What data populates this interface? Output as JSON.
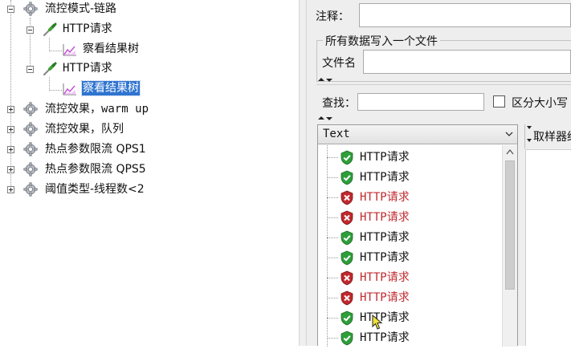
{
  "tree": {
    "items": [
      {
        "label": "流控模式-链路",
        "expander": "minus",
        "icon": "gear-icon"
      },
      {
        "label": "HTTP请求",
        "expander": "minus",
        "icon": "pipette-icon"
      },
      {
        "label": "察看结果树",
        "icon": "graph-icon"
      },
      {
        "label": "HTTP请求",
        "expander": "minus",
        "icon": "pipette-icon"
      },
      {
        "label": "察看结果树",
        "icon": "graph-icon",
        "selected": true
      },
      {
        "label": "流控效果，warm up",
        "expander": "plus",
        "icon": "gear-icon"
      },
      {
        "label": "流控效果，队列",
        "expander": "plus",
        "icon": "gear-icon"
      },
      {
        "label": "热点参数限流 QPS1",
        "expander": "plus",
        "icon": "gear-icon"
      },
      {
        "label": "热点参数限流 QPS5",
        "expander": "plus",
        "icon": "gear-icon"
      },
      {
        "label": "阈值类型-线程数<2",
        "expander": "plus",
        "icon": "gear-icon"
      }
    ]
  },
  "form": {
    "comment_label": "注释：",
    "comment_value": "",
    "fieldset_title": "所有数据写入一个文件",
    "filename_label": "文件名",
    "filename_value": ""
  },
  "search": {
    "label": "查找：",
    "value": "",
    "case_label": "区分大小写",
    "case_checked": false
  },
  "results": {
    "renderer": "Text",
    "rows": [
      {
        "label": "HTTP请求",
        "status": "success"
      },
      {
        "label": "HTTP请求",
        "status": "success"
      },
      {
        "label": "HTTP请求",
        "status": "error"
      },
      {
        "label": "HTTP请求",
        "status": "error"
      },
      {
        "label": "HTTP请求",
        "status": "success"
      },
      {
        "label": "HTTP请求",
        "status": "success"
      },
      {
        "label": "HTTP请求",
        "status": "error"
      },
      {
        "label": "HTTP请求",
        "status": "error"
      },
      {
        "label": "HTTP请求",
        "status": "success"
      },
      {
        "label": "HTTP请求",
        "status": "success"
      }
    ]
  },
  "sampler_tab": {
    "label": "取样器结"
  },
  "colors": {
    "selection": "#2f74d0",
    "error_text": "#c0282d",
    "success_shield": "#2e9e3a",
    "error_shield": "#c0282d"
  }
}
